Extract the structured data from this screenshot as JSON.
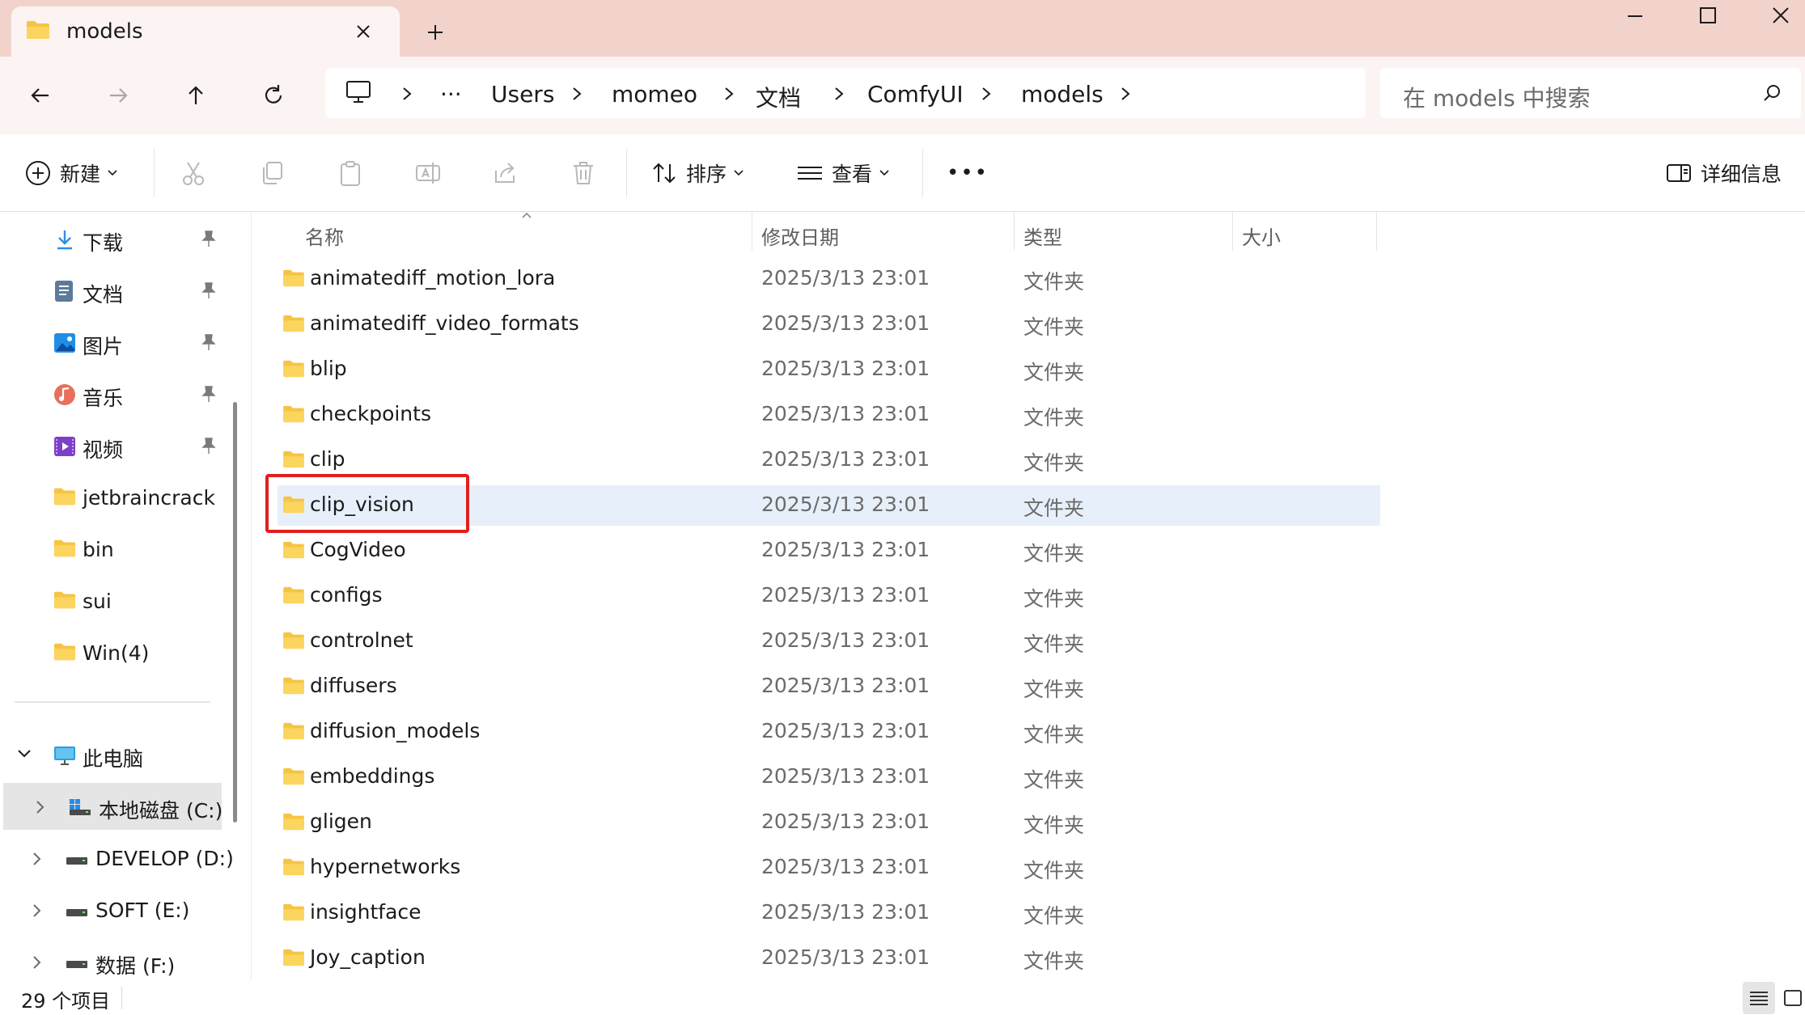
{
  "tab": {
    "title": "models"
  },
  "breadcrumb": {
    "more": "···",
    "items": [
      "Users",
      "momeo",
      "文档",
      "ComfyUI",
      "models"
    ]
  },
  "search": {
    "placeholder": "在 models 中搜索"
  },
  "commands": {
    "new": "新建",
    "sort": "排序",
    "view": "查看",
    "more": "•••",
    "details": "详细信息"
  },
  "sidebar": {
    "quick_access": [
      {
        "label": "下载",
        "icon": "download-icon"
      },
      {
        "label": "文档",
        "icon": "document-icon"
      },
      {
        "label": "图片",
        "icon": "pictures-icon"
      },
      {
        "label": "音乐",
        "icon": "music-icon"
      },
      {
        "label": "视频",
        "icon": "video-icon"
      },
      {
        "label": "jetbraincrack",
        "icon": "folder-icon"
      },
      {
        "label": "bin",
        "icon": "folder-icon"
      },
      {
        "label": "sui",
        "icon": "folder-icon"
      },
      {
        "label": "Win(4)",
        "icon": "folder-icon"
      }
    ],
    "this_pc": "此电脑",
    "drives": [
      {
        "label": "本地磁盘 (C:)",
        "selected": true
      },
      {
        "label": "DEVELOP (D:)",
        "selected": false
      },
      {
        "label": "SOFT (E:)",
        "selected": false
      },
      {
        "label": "数据 (F:)",
        "selected": false
      }
    ]
  },
  "columns": {
    "name": "名称",
    "date": "修改日期",
    "type": "类型",
    "size": "大小"
  },
  "files": [
    {
      "name": "animatediff_motion_lora",
      "date": "2025/3/13 23:01",
      "type": "文件夹"
    },
    {
      "name": "animatediff_video_formats",
      "date": "2025/3/13 23:01",
      "type": "文件夹"
    },
    {
      "name": "blip",
      "date": "2025/3/13 23:01",
      "type": "文件夹"
    },
    {
      "name": "checkpoints",
      "date": "2025/3/13 23:01",
      "type": "文件夹"
    },
    {
      "name": "clip",
      "date": "2025/3/13 23:01",
      "type": "文件夹"
    },
    {
      "name": "clip_vision",
      "date": "2025/3/13 23:01",
      "type": "文件夹"
    },
    {
      "name": "CogVideo",
      "date": "2025/3/13 23:01",
      "type": "文件夹"
    },
    {
      "name": "configs",
      "date": "2025/3/13 23:01",
      "type": "文件夹"
    },
    {
      "name": "controlnet",
      "date": "2025/3/13 23:01",
      "type": "文件夹"
    },
    {
      "name": "diffusers",
      "date": "2025/3/13 23:01",
      "type": "文件夹"
    },
    {
      "name": "diffusion_models",
      "date": "2025/3/13 23:01",
      "type": "文件夹"
    },
    {
      "name": "embeddings",
      "date": "2025/3/13 23:01",
      "type": "文件夹"
    },
    {
      "name": "gligen",
      "date": "2025/3/13 23:01",
      "type": "文件夹"
    },
    {
      "name": "hypernetworks",
      "date": "2025/3/13 23:01",
      "type": "文件夹"
    },
    {
      "name": "insightface",
      "date": "2025/3/13 23:01",
      "type": "文件夹"
    },
    {
      "name": "Joy_caption",
      "date": "2025/3/13 23:01",
      "type": "文件夹"
    }
  ],
  "selected_file": "clip_vision",
  "status": {
    "count": "29 个项目"
  },
  "colors": {
    "folder": "#f6c444",
    "selection": "#e7f0fa",
    "highlight_box": "#e0201e",
    "accent": "#0067c0"
  }
}
